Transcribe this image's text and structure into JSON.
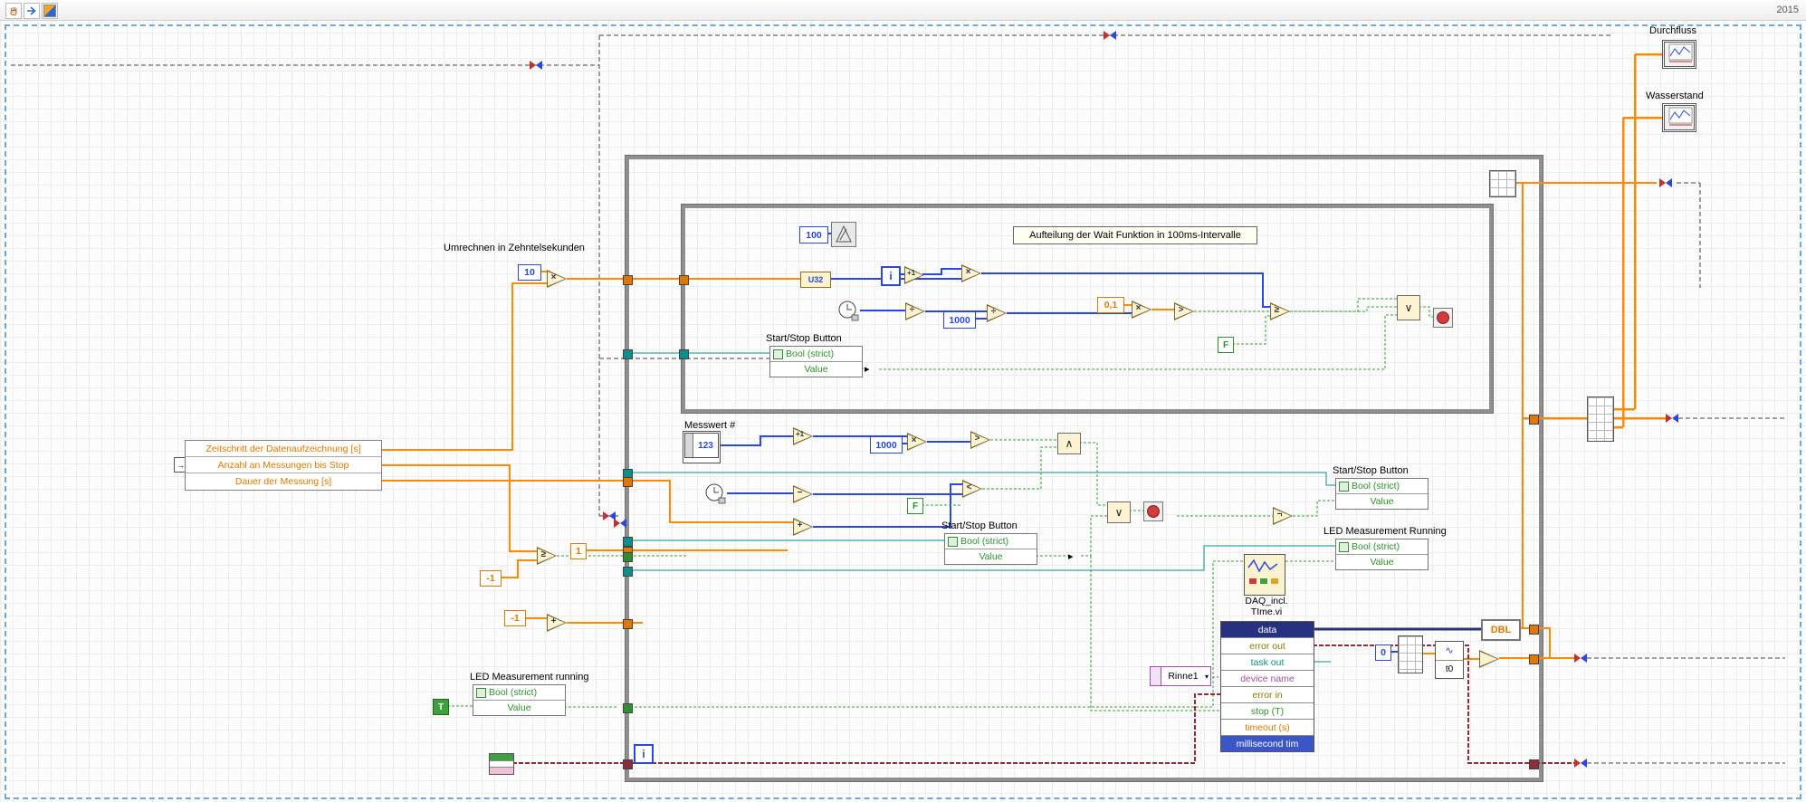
{
  "toolbar": {
    "year": "2015"
  },
  "free_labels": {
    "umrechnen": "Umrechnen in Zehntelsekunden",
    "aufteilung": "Aufteilung der Wait Funktion in 100ms-Intervalle",
    "messwert": "Messwert #"
  },
  "charts": {
    "durchfluss": "Durchfluss",
    "wasserstand": "Wasserstand"
  },
  "cluster_constant": {
    "rows": [
      "Zeitschritt der Datenaufzeichnung [s]",
      "Anzahl an Messungen bis Stop",
      "Dauer der Messung [s]"
    ]
  },
  "property_nodes": {
    "inner_start_stop": {
      "label": "Start/Stop Button",
      "class_row": "Bool (strict)",
      "property_row": "Value"
    },
    "center_start_stop": {
      "label": "Start/Stop Button",
      "class_row": "Bool (strict)",
      "property_row": "Value"
    },
    "right_start_stop": {
      "label": "Start/Stop Button",
      "class_row": "Bool (strict)",
      "property_row": "Value"
    },
    "led_running_right": {
      "label": "LED Measurement Running",
      "class_row": "Bool (strict)",
      "property_row": "Value"
    },
    "led_running_left": {
      "label": "LED Measurement running",
      "class_row": "Bool (strict)",
      "property_row": "Value"
    }
  },
  "daq_vi": {
    "title_line1": "DAQ_incl.",
    "title_line2": "TIme.vi",
    "terminals": [
      "data",
      "error out",
      "task out",
      "device name",
      "error in",
      "stop (T)",
      "timeout (s)",
      "millisecond tim"
    ]
  },
  "constants": {
    "wait_interval": "100",
    "ms_divisor": "1000",
    "ms_factor": "1000",
    "tenths_factor": "10",
    "tenth_second": "0,1",
    "one": "1",
    "minus_one_a": "-1",
    "minus_one_b": "-1",
    "zero": "0",
    "true_const": "T",
    "false_inner": "F",
    "false_outer": "F",
    "u32_conversion": "U32",
    "dbl_indicator": "DBL",
    "iteration_outer": "i",
    "iteration_inner": "i",
    "t0_component": "t0",
    "device_name": "Rinne1"
  },
  "node_symbols": {
    "multiply": "×",
    "divide": "÷",
    "increment": "+1",
    "add": "+",
    "subtract": "−",
    "greater": ">",
    "less": "<",
    "greater_equal": "≥",
    "and": "∧",
    "or": "∨",
    "not": "¬",
    "blank": ""
  },
  "icons": {
    "read_arrow": "▸",
    "dropdown": "▾",
    "sine": "∿",
    "cluster_arrow": "→"
  },
  "colors": {
    "dbl_orange": "#e07800",
    "int_blue": "#2a48e0",
    "bool_green": "#2f8f2f",
    "error_maroon": "#8c2e39",
    "task_teal": "#0a8f8f",
    "name_purple": "#a14fa1",
    "dynamic_blue": "#26327f",
    "structure_gray": "#8f8f8f",
    "frame_dashed_blue": "#6fa8dc"
  }
}
